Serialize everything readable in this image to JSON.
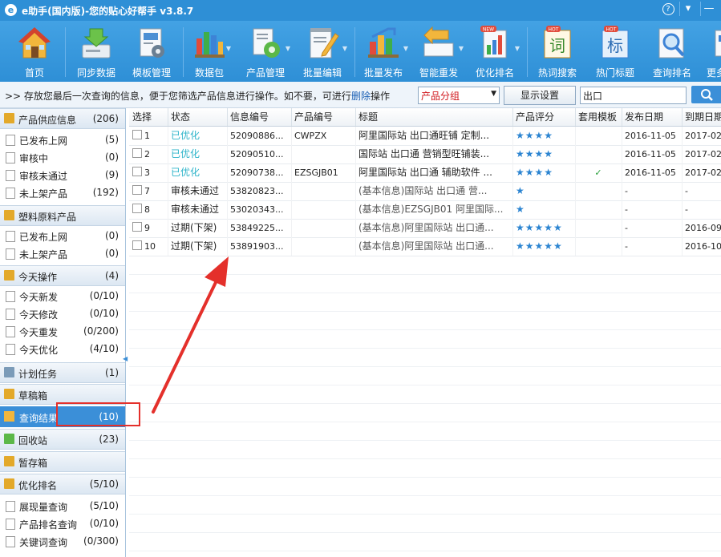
{
  "window": {
    "title": "e助手(国内版)-您的贴心好帮手 v3.8.7",
    "logo": "e",
    "help_glyph": "?",
    "menu_glyph": "▾",
    "min_glyph": "—"
  },
  "toolbar": {
    "items": [
      {
        "label": "首页",
        "icon": "home-icon"
      },
      {
        "label": "同步数据",
        "icon": "sync-download-icon"
      },
      {
        "label": "模板管理",
        "icon": "template-gear-icon"
      },
      {
        "label": "数据包",
        "icon": "data-package-icon"
      },
      {
        "label": "产品管理",
        "icon": "product-gear-icon"
      },
      {
        "label": "批量编辑",
        "icon": "batch-edit-icon"
      },
      {
        "label": "批量发布",
        "icon": "batch-publish-icon"
      },
      {
        "label": "智能重发",
        "icon": "smart-republish-icon"
      },
      {
        "label": "优化排名",
        "icon": "optimize-rank-icon"
      },
      {
        "label": "热词搜索",
        "icon": "hot-word-icon"
      },
      {
        "label": "热门标题",
        "icon": "hot-title-icon"
      },
      {
        "label": "查询排名",
        "icon": "query-rank-icon"
      },
      {
        "label": "更多",
        "icon": "more-icon"
      }
    ],
    "badges": {
      "hot": "HOT",
      "new": "NEW",
      "ci": "词",
      "biao": "标"
    }
  },
  "infobar": {
    "message": ">> 存放您最后一次查询的信息，便于您筛选产品信息进行操作。如不要，可进行",
    "link": "删除",
    "message_tail": "操作",
    "group_select": "产品分组",
    "display_settings": "显示设置",
    "search_value": "出口"
  },
  "sidebar": {
    "sections": [
      {
        "label": "产品供应信息",
        "count": "(206)",
        "items": [
          {
            "label": "已发布上网",
            "count": "(5)"
          },
          {
            "label": "审核中",
            "count": "(0)"
          },
          {
            "label": "审核未通过",
            "count": "(9)"
          },
          {
            "label": "未上架产品",
            "count": "(192)"
          }
        ]
      },
      {
        "label": "塑料原料产品",
        "count": "",
        "items": [
          {
            "label": "已发布上网",
            "count": "(0)"
          },
          {
            "label": "未上架产品",
            "count": "(0)"
          }
        ]
      },
      {
        "label": "今天操作",
        "count": "(4)",
        "items": [
          {
            "label": "今天新发",
            "count": "(0/10)"
          },
          {
            "label": "今天修改",
            "count": "(0/10)"
          },
          {
            "label": "今天重发",
            "count": "(0/200)"
          },
          {
            "label": "今天优化",
            "count": "(4/10)"
          }
        ]
      },
      {
        "label": "计划任务",
        "count": "(1)",
        "items": []
      },
      {
        "label": "草稿箱",
        "count": "",
        "items": []
      },
      {
        "label": "查询结果",
        "count": "(10)",
        "items": []
      },
      {
        "label": "回收站",
        "count": "(23)",
        "items": []
      },
      {
        "label": "暂存箱",
        "count": "",
        "items": []
      },
      {
        "label": "优化排名",
        "count": "(5/10)",
        "items": [
          {
            "label": "展现量查询",
            "count": "(5/10)"
          },
          {
            "label": "产品排名查询",
            "count": "(0/10)"
          },
          {
            "label": "关键词查询",
            "count": "(0/300)"
          }
        ]
      }
    ]
  },
  "table": {
    "columns": [
      "选择",
      "状态",
      "信息编号",
      "产品编号",
      "标题",
      "产品评分",
      "套用模板",
      "发布日期",
      "到期日期"
    ],
    "rows": [
      {
        "num": "1",
        "status": "已优化",
        "info_id": "52090886...",
        "product_id": "CWPZX",
        "title": "阿里国际站 出口通旺铺 定制...",
        "stars": "★★★★",
        "template": "",
        "pub_date": "2016-11-05",
        "exp_date": "2017-02-..."
      },
      {
        "num": "2",
        "status": "已优化",
        "info_id": "52090510...",
        "product_id": "",
        "title": "国际站 出口通 营销型旺铺装...",
        "stars": "★★★★",
        "template": "",
        "pub_date": "2016-11-05",
        "exp_date": "2017-02-..."
      },
      {
        "num": "3",
        "status": "已优化",
        "info_id": "52090738...",
        "product_id": "EZSGJB01",
        "title": "阿里国际站 出口通 辅助软件 ...",
        "stars": "★★★★",
        "template": "✓",
        "pub_date": "2016-11-05",
        "exp_date": "2017-02-..."
      },
      {
        "num": "7",
        "status": "审核未通过",
        "info_id": "53820823...",
        "product_id": "",
        "title": "(基本信息)国际站 出口通 营...",
        "stars": "★",
        "template": "",
        "pub_date": "-",
        "exp_date": "-"
      },
      {
        "num": "8",
        "status": "审核未通过",
        "info_id": "53020343...",
        "product_id": "",
        "title": "(基本信息)EZSGJB01 阿里国际...",
        "stars": "★",
        "template": "",
        "pub_date": "-",
        "exp_date": "-"
      },
      {
        "num": "9",
        "status": "过期(下架)",
        "info_id": "53849225...",
        "product_id": "",
        "title": "(基本信息)阿里国际站 出口通...",
        "stars": "★★★★★",
        "template": "",
        "pub_date": "-",
        "exp_date": "2016-09-..."
      },
      {
        "num": "10",
        "status": "过期(下架)",
        "info_id": "53891903...",
        "product_id": "",
        "title": "(基本信息)阿里国际站 出口通...",
        "stars": "★★★★★",
        "template": "",
        "pub_date": "-",
        "exp_date": "2016-10-..."
      }
    ]
  },
  "colors": {
    "title_bar": "#2e8fd6",
    "optimized_status": "#2bb3c9",
    "stars": "#2b84d1",
    "annotation_red": "#e4302b",
    "active_item": "#3b8fd8"
  }
}
